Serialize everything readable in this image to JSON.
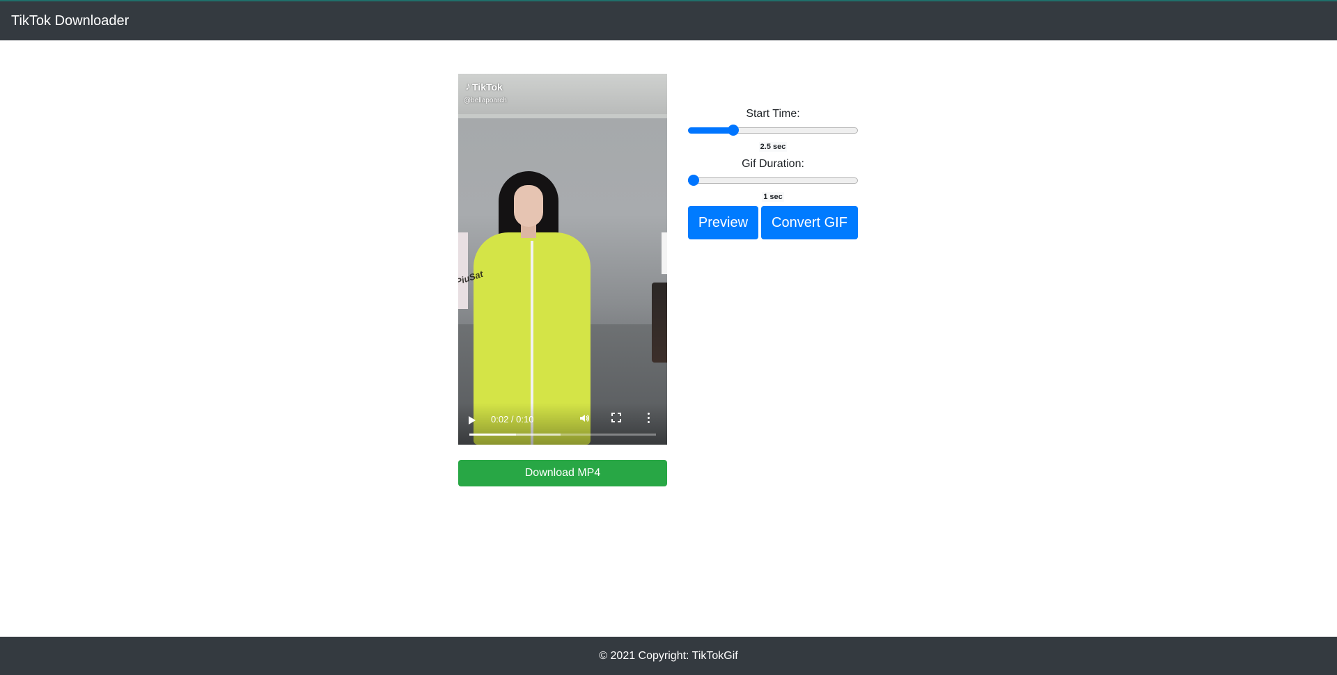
{
  "navbar": {
    "brand": "TikTok Downloader"
  },
  "video": {
    "watermark_logo_text": "TikTok",
    "watermark_handle": "@bellapoarch",
    "time_display": "0:02 / 0:10",
    "current_time_sec": 2.5,
    "duration_sec": 10,
    "played_fraction": 0.25,
    "buffered_fraction": 0.49,
    "icons": {
      "play": "play-icon",
      "volume": "volume-icon",
      "fullscreen": "fullscreen-icon",
      "more": "more-vertical-icon"
    },
    "jacket_print_text": "PiuSat"
  },
  "download": {
    "label": "Download MP4",
    "color": "#28a745"
  },
  "gif_panel": {
    "start_time": {
      "label": "Start Time:",
      "value_text": "2.5 sec",
      "value": 2.5,
      "min": 0,
      "max": 10
    },
    "duration": {
      "label": "Gif Duration:",
      "value_text": "1 sec",
      "value": 1,
      "min": 1,
      "max": 10
    },
    "preview_label": "Preview",
    "convert_label": "Convert GIF",
    "accent": "#007bff"
  },
  "footer": {
    "text": "© 2021 Copyright: TikTokGif"
  }
}
